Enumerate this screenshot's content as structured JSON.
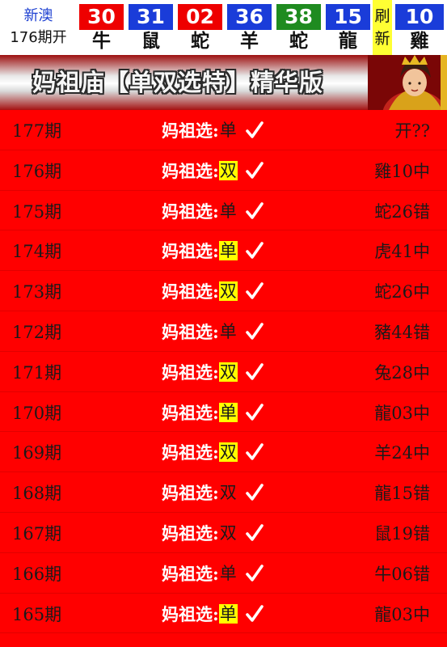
{
  "header": {
    "lottery_name": "新澳",
    "period_label": "176期开",
    "refresh_label": [
      "刷",
      "新"
    ],
    "balls": [
      {
        "number": "30",
        "zodiac": "牛",
        "color": "#ee0000"
      },
      {
        "number": "31",
        "zodiac": "鼠",
        "color": "#1a3cd9"
      },
      {
        "number": "02",
        "zodiac": "蛇",
        "color": "#ee0000"
      },
      {
        "number": "36",
        "zodiac": "羊",
        "color": "#1a3cd9"
      },
      {
        "number": "38",
        "zodiac": "蛇",
        "color": "#1f8b20"
      },
      {
        "number": "15",
        "zodiac": "龍",
        "color": "#1a3cd9"
      }
    ],
    "special_ball": {
      "number": "10",
      "zodiac": "雞",
      "color": "#1a3cd9"
    }
  },
  "banner": {
    "title": "妈祖庙【单双选特】精华版"
  },
  "pick_label": "妈祖选:",
  "records": [
    {
      "period": "177期",
      "pick": "单",
      "highlight": false,
      "result": "开??"
    },
    {
      "period": "176期",
      "pick": "双",
      "highlight": true,
      "result": "雞10中"
    },
    {
      "period": "175期",
      "pick": "单",
      "highlight": false,
      "result": "蛇26错"
    },
    {
      "period": "174期",
      "pick": "单",
      "highlight": true,
      "result": "虎41中"
    },
    {
      "period": "173期",
      "pick": "双",
      "highlight": true,
      "result": "蛇26中"
    },
    {
      "period": "172期",
      "pick": "单",
      "highlight": false,
      "result": "豬44错"
    },
    {
      "period": "171期",
      "pick": "双",
      "highlight": true,
      "result": "兔28中"
    },
    {
      "period": "170期",
      "pick": "单",
      "highlight": true,
      "result": "龍03中"
    },
    {
      "period": "169期",
      "pick": "双",
      "highlight": true,
      "result": "羊24中"
    },
    {
      "period": "168期",
      "pick": "双",
      "highlight": false,
      "result": "龍15错"
    },
    {
      "period": "167期",
      "pick": "双",
      "highlight": false,
      "result": "鼠19错"
    },
    {
      "period": "166期",
      "pick": "单",
      "highlight": false,
      "result": "牛06错"
    },
    {
      "period": "165期",
      "pick": "单",
      "highlight": true,
      "result": "龍03中"
    }
  ],
  "colors": {
    "page_background": "#ff0000",
    "highlight": "#ffff00",
    "refresh_background": "#ffff33"
  },
  "icons": {
    "row_check": "check-icon",
    "banner_image": "mazu-statue-icon"
  }
}
